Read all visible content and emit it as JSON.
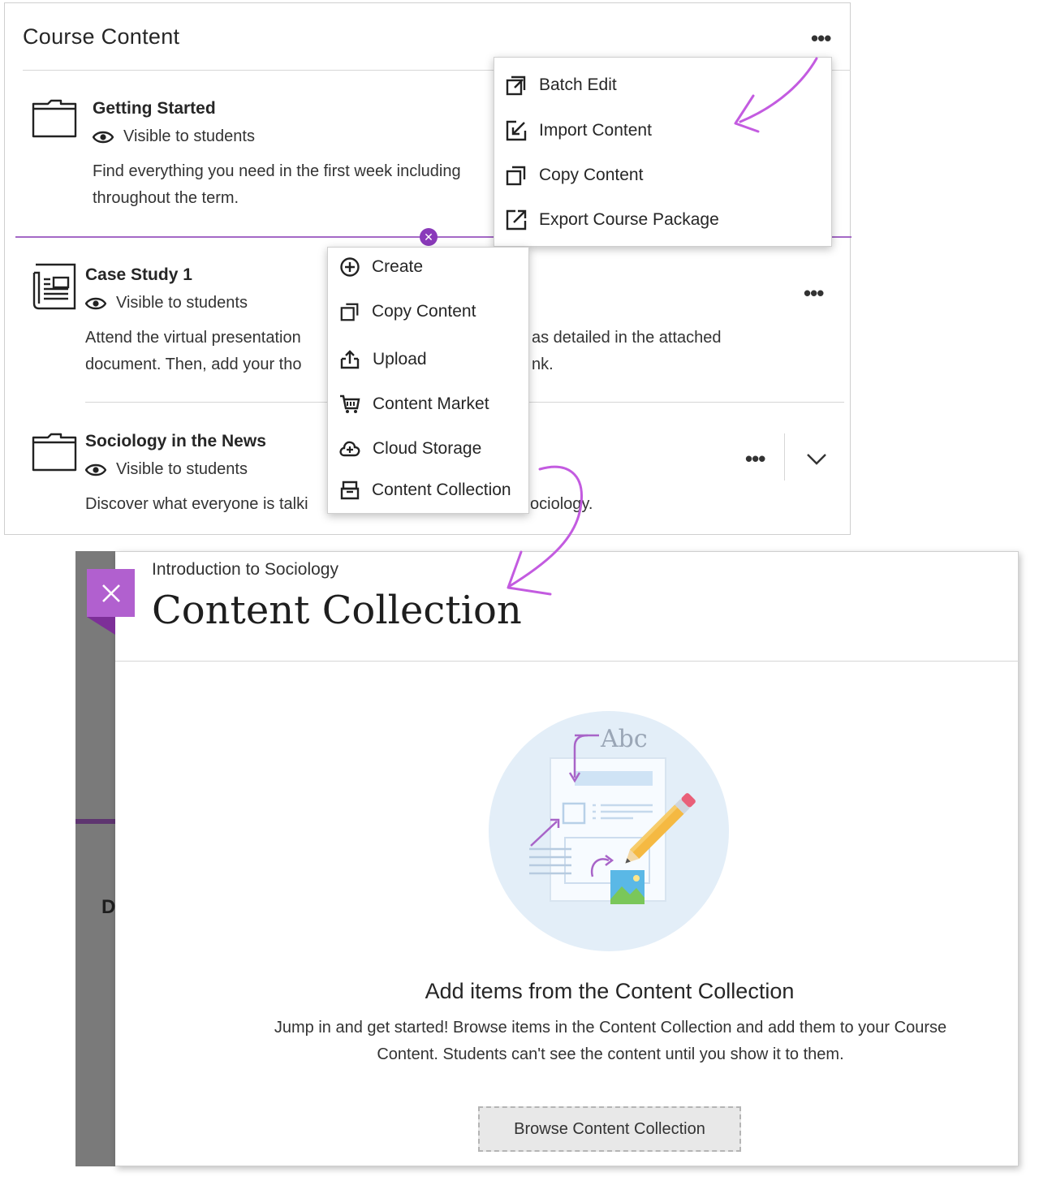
{
  "course_content": {
    "title": "Course Content",
    "items": [
      {
        "title": "Getting Started",
        "visibility": "Visible to students",
        "description_line1": "Find everything you need in the first week including",
        "description_line2": "throughout the term."
      },
      {
        "title": "Case Study 1",
        "visibility": "Visible to students",
        "description_line1a": "Attend the virtual presentation",
        "description_line1b": "as detailed in the attached",
        "description_line2a": "document. Then, add your tho",
        "description_line2b": "nk."
      },
      {
        "title": "Sociology in the News",
        "visibility": "Visible to students",
        "description_a": "Discover what everyone is talki",
        "description_b": "ociology."
      }
    ]
  },
  "more_menu": {
    "items": [
      {
        "label": "Batch Edit",
        "icon": "batch-edit-icon"
      },
      {
        "label": "Import Content",
        "icon": "import-icon"
      },
      {
        "label": "Copy Content",
        "icon": "copy-icon"
      },
      {
        "label": "Export Course Package",
        "icon": "export-icon"
      }
    ]
  },
  "add_menu": {
    "items": [
      {
        "label": "Create",
        "icon": "plus-circle-icon"
      },
      {
        "label": "Copy Content",
        "icon": "copy-icon"
      },
      {
        "label": "Upload",
        "icon": "upload-icon"
      },
      {
        "label": "Content Market",
        "icon": "cart-icon"
      },
      {
        "label": "Cloud Storage",
        "icon": "cloud-icon"
      },
      {
        "label": "Content Collection",
        "icon": "archive-icon"
      }
    ]
  },
  "modal": {
    "subtitle": "Introduction to Sociology",
    "title": "Content Collection",
    "illustration_text": "Abc",
    "empty_title": "Add items from the Content Collection",
    "empty_text": "Jump in and get started! Browse items in the Content Collection and add them to your Course Content. Students can't see the content until you show it to them.",
    "browse_button": "Browse Content Collection",
    "background_letter": "D"
  },
  "colors": {
    "accent_purple": "#8a3aba",
    "close_button": "#b160cf",
    "annotation_arrow": "#c35be0"
  }
}
